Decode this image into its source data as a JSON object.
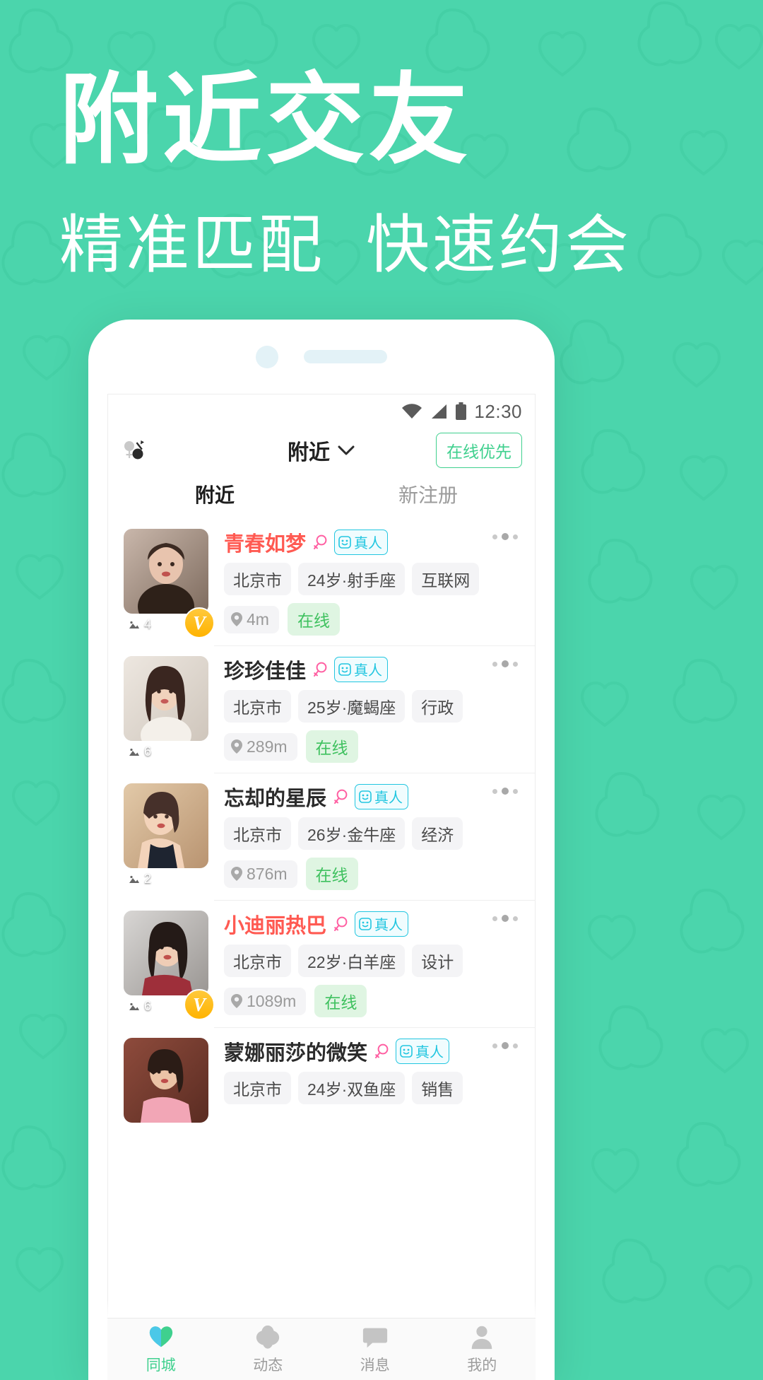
{
  "promo": {
    "title": "附近交友",
    "subtitle": "精准匹配  快速约会",
    "bg_color": "#4BD5AC",
    "text_color": "#FFFFFF"
  },
  "statusbar": {
    "time": "12:30",
    "icons": [
      "wifi-icon",
      "signal-icon",
      "battery-icon"
    ]
  },
  "appbar": {
    "gender_filter_icon": "gender-filter-icon",
    "title": "附近",
    "dropdown_icon": "chevron-down-icon",
    "online_first_label": "在线优先",
    "accent_color": "#3FD08E"
  },
  "tabs": [
    {
      "label": "附近",
      "active": true
    },
    {
      "label": "新注册",
      "active": false
    }
  ],
  "cards": [
    {
      "nick": "青春如梦",
      "nick_hot": true,
      "gender_icon": "female-icon",
      "real_badge": "真人",
      "photo_count": "4",
      "v_badge": "V",
      "tags": [
        "北京市",
        "24岁·射手座",
        "互联网"
      ],
      "distance": "4m",
      "status": "在线"
    },
    {
      "nick": "珍珍佳佳",
      "nick_hot": false,
      "gender_icon": "female-icon",
      "real_badge": "真人",
      "photo_count": "6",
      "v_badge": "",
      "tags": [
        "北京市",
        "25岁·魔蝎座",
        "行政"
      ],
      "distance": "289m",
      "status": "在线"
    },
    {
      "nick": "忘却的星辰",
      "nick_hot": false,
      "gender_icon": "female-icon",
      "real_badge": "真人",
      "photo_count": "2",
      "v_badge": "",
      "tags": [
        "北京市",
        "26岁·金牛座",
        "经济"
      ],
      "distance": "876m",
      "status": "在线"
    },
    {
      "nick": "小迪丽热巴",
      "nick_hot": true,
      "gender_icon": "female-icon",
      "real_badge": "真人",
      "photo_count": "6",
      "v_badge": "V",
      "tags": [
        "北京市",
        "22岁·白羊座",
        "设计"
      ],
      "distance": "1089m",
      "status": "在线"
    },
    {
      "nick": "蒙娜丽莎的微笑",
      "nick_hot": false,
      "gender_icon": "female-icon",
      "real_badge": "真人",
      "photo_count": "",
      "v_badge": "",
      "tags": [
        "北京市",
        "24岁·双鱼座",
        "销售"
      ],
      "distance": "",
      "status": ""
    }
  ],
  "bottomnav": [
    {
      "label": "同城",
      "icon": "heart-icon",
      "active": true
    },
    {
      "label": "动态",
      "icon": "star-icon",
      "active": false
    },
    {
      "label": "消息",
      "icon": "chat-icon",
      "active": false
    },
    {
      "label": "我的",
      "icon": "person-icon",
      "active": false
    }
  ]
}
